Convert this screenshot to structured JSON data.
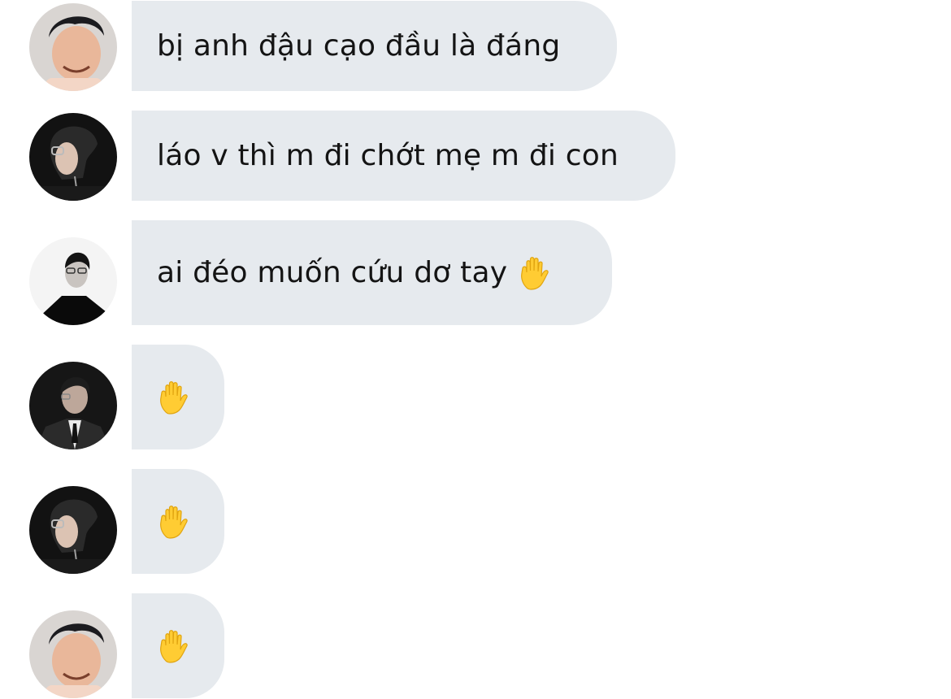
{
  "messages": [
    {
      "avatar": "avatar-young-man-smiling",
      "text": "bị anh đậu cạo đầu là đáng",
      "emoji": ""
    },
    {
      "avatar": "avatar-man-glasses-profile",
      "text": "láo v thì m đi chớt mẹ m đi con",
      "emoji": ""
    },
    {
      "avatar": "avatar-man-glasses-bw",
      "text": "ai đéo muốn cứu dơ tay",
      "emoji": "raised-hand"
    },
    {
      "avatar": "avatar-man-suit",
      "text": "",
      "emoji": "raised-hand"
    },
    {
      "avatar": "avatar-man-glasses-profile",
      "text": "",
      "emoji": "raised-hand"
    },
    {
      "avatar": "avatar-young-man-smiling",
      "text": "",
      "emoji": "raised-hand"
    }
  ],
  "colors": {
    "bubble": "#e6eaee",
    "text": "#141414",
    "hand": "#ffcc33"
  }
}
